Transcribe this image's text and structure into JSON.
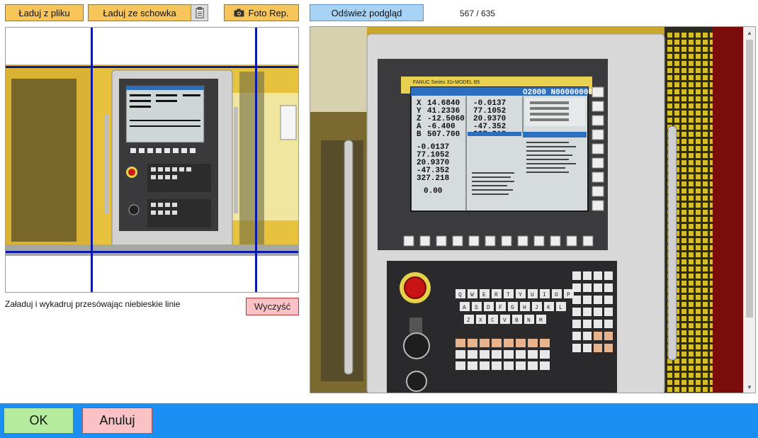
{
  "toolbar": {
    "load_file_label": "Ładuj z pliku",
    "load_clipboard_label": "Ładuj ze schowka",
    "clipboard_icon": "clipboard-icon",
    "photo_label": "Foto Rep.",
    "photo_icon": "camera-icon",
    "refresh_label": "Odśwież podgląd"
  },
  "counter": "567 / 635",
  "crop": {
    "hint": "Załaduj i wykadruj przesówając niebieskie linie",
    "clear_label": "Wyczyść"
  },
  "screen_readout": {
    "program": "O2000 N00000000",
    "values_left": [
      "14.6840",
      "41.2336",
      "-12.5060",
      "-6.400",
      "507.700"
    ],
    "axes": [
      "X",
      "Y",
      "Z",
      "A",
      "B"
    ],
    "values_right": [
      "-0.0137",
      "77.1052",
      "20.9370",
      "-47.352",
      "327.218"
    ],
    "values_lower": [
      "-0.0137",
      "77.1052",
      "20.9370",
      "-47.352",
      "327.218"
    ],
    "feed": "0.00",
    "brand": "FANUC Series 31i-MODEL B5"
  },
  "keypad_letters": [
    "Q",
    "W",
    "E",
    "R",
    "T",
    "Y",
    "U",
    "I",
    "O",
    "P",
    "A",
    "S",
    "D",
    "F",
    "G",
    "H",
    "J",
    "K",
    "L",
    "Z",
    "X",
    "C",
    "V",
    "B",
    "N",
    "M"
  ],
  "footer": {
    "ok_label": "OK",
    "cancel_label": "Anuluj"
  },
  "colors": {
    "toolbar_button": "#f8c55a",
    "refresh_button": "#a6d3f6",
    "crop_line": "#0a1aa8",
    "footer_bar": "#1b8ff3",
    "ok_button": "#b5eb9c",
    "cancel_button": "#fbc2c6"
  }
}
